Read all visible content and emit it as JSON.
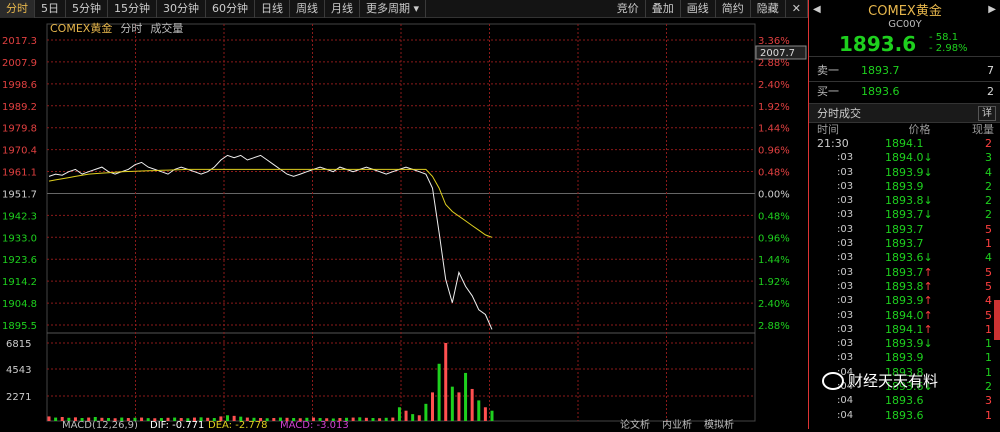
{
  "toolbar": {
    "tabs": [
      "分时",
      "5日",
      "5分钟",
      "15分钟",
      "30分钟",
      "60分钟",
      "日线",
      "周线",
      "月线",
      "更多周期"
    ],
    "right": [
      "竞价",
      "叠加",
      "画线",
      "简约",
      "隐藏"
    ]
  },
  "legend": {
    "title": "COMEX黄金",
    "items": [
      "分时",
      "成交量"
    ]
  },
  "price_axis": {
    "left": [
      "2017.3",
      "2007.9",
      "1998.6",
      "1989.2",
      "1979.8",
      "1970.4",
      "1961.1",
      "1951.7",
      "1942.3",
      "1933.0",
      "1923.6",
      "1914.2",
      "1904.8",
      "1895.5"
    ],
    "right": [
      "3.36%",
      "2.88%",
      "2.40%",
      "1.92%",
      "1.44%",
      "0.96%",
      "0.48%",
      "0.00%",
      "0.48%",
      "0.96%",
      "1.44%",
      "1.92%",
      "2.40%",
      "2.88%"
    ],
    "current_label": "2007.7"
  },
  "volume_axis": [
    "6815",
    "4543",
    "2271"
  ],
  "bottom_bar": [
    "MACD(12,26,9)",
    "DIF: -0.771",
    "DEA: -2.778",
    "MACD: -3.013"
  ],
  "bottom_right": [
    "论文析",
    "内业析",
    "模拟析"
  ],
  "chart_data": {
    "type": "line",
    "ylim": [
      1895.5,
      2017.3
    ],
    "baseline": 1951.7,
    "series": [
      {
        "values": [
          1959,
          1960,
          1959.5,
          1961,
          1962,
          1960,
          1961,
          1962,
          1963,
          1961,
          1960,
          1961,
          1962,
          1964,
          1965,
          1963,
          1962,
          1961,
          1960,
          1962,
          1963,
          1962,
          1961,
          1960,
          1961,
          1963,
          1966,
          1968,
          1967,
          1968,
          1966,
          1967,
          1968,
          1966,
          1964,
          1962,
          1960,
          1959,
          1960,
          1961,
          1962,
          1963,
          1962,
          1961,
          1963,
          1962,
          1961,
          1962,
          1963,
          1962,
          1961,
          1960,
          1961,
          1962,
          1963,
          1962,
          1961,
          1960,
          1954,
          1935,
          1915,
          1905,
          1918,
          1912,
          1908,
          1902,
          1900,
          1893.6
        ]
      },
      {
        "values": [
          1957,
          1957.5,
          1958,
          1958.5,
          1959,
          1959.5,
          1960,
          1960.2,
          1960.4,
          1960.6,
          1960.8,
          1961,
          1961.1,
          1961.2,
          1961.3,
          1961.4,
          1961.5,
          1961.6,
          1961.7,
          1961.8,
          1961.9,
          1962,
          1962,
          1962,
          1962,
          1962,
          1962,
          1962,
          1962,
          1962,
          1962,
          1962,
          1962,
          1962,
          1962,
          1962,
          1962,
          1962,
          1962,
          1962,
          1962,
          1962,
          1962,
          1962,
          1962,
          1962,
          1962,
          1962,
          1962,
          1962,
          1962,
          1962,
          1962,
          1962,
          1962,
          1962,
          1962,
          1962,
          1959,
          1954,
          1947,
          1944,
          1942,
          1940,
          1938,
          1936,
          1934,
          1933
        ]
      }
    ],
    "volume": [
      400,
      300,
      350,
      280,
      320,
      260,
      300,
      350,
      280,
      260,
      240,
      300,
      260,
      280,
      300,
      250,
      240,
      260,
      280,
      300,
      260,
      240,
      300,
      320,
      280,
      260,
      400,
      500,
      450,
      380,
      300,
      280,
      260,
      240,
      260,
      300,
      280,
      260,
      240,
      280,
      300,
      260,
      240,
      220,
      260,
      280,
      300,
      320,
      280,
      260,
      240,
      280,
      300,
      1200,
      900,
      600,
      500,
      1500,
      2500,
      5000,
      6815,
      3000,
      2500,
      4200,
      2800,
      1800,
      1200,
      900
    ]
  },
  "panel": {
    "name": "COMEX黄金",
    "code": "GC00Y",
    "price": "1893.6",
    "change": "- 58.1",
    "change_pct": "- 2.98%",
    "ask_label": "卖一",
    "ask_price": "1893.7",
    "ask_vol": "7",
    "bid_label": "买一",
    "bid_price": "1893.6",
    "bid_vol": "2",
    "section_title": "分时成交",
    "detail_btn": "详",
    "col_time": "时间",
    "col_price": "价格",
    "col_vol": "现量",
    "trades": [
      {
        "time": "21:30",
        "price": "1894.1",
        "arrow": "",
        "vol": "2",
        "dir": "up"
      },
      {
        "time": ":03",
        "price": "1894.0",
        "arrow": "↓",
        "vol": "3",
        "dir": "dn"
      },
      {
        "time": ":03",
        "price": "1893.9",
        "arrow": "↓",
        "vol": "4",
        "dir": "dn"
      },
      {
        "time": ":03",
        "price": "1893.9",
        "arrow": "",
        "vol": "2",
        "dir": "dn"
      },
      {
        "time": ":03",
        "price": "1893.8",
        "arrow": "↓",
        "vol": "2",
        "dir": "dn"
      },
      {
        "time": ":03",
        "price": "1893.7",
        "arrow": "↓",
        "vol": "2",
        "dir": "dn"
      },
      {
        "time": ":03",
        "price": "1893.7",
        "arrow": "",
        "vol": "5",
        "dir": "up"
      },
      {
        "time": ":03",
        "price": "1893.7",
        "arrow": "",
        "vol": "1",
        "dir": "up"
      },
      {
        "time": ":03",
        "price": "1893.6",
        "arrow": "↓",
        "vol": "4",
        "dir": "dn"
      },
      {
        "time": ":03",
        "price": "1893.7",
        "arrow": "↑",
        "vol": "5",
        "dir": "up"
      },
      {
        "time": ":03",
        "price": "1893.8",
        "arrow": "↑",
        "vol": "5",
        "dir": "up"
      },
      {
        "time": ":03",
        "price": "1893.9",
        "arrow": "↑",
        "vol": "4",
        "dir": "up"
      },
      {
        "time": ":03",
        "price": "1894.0",
        "arrow": "↑",
        "vol": "5",
        "dir": "up"
      },
      {
        "time": ":03",
        "price": "1894.1",
        "arrow": "↑",
        "vol": "1",
        "dir": "up"
      },
      {
        "time": ":03",
        "price": "1893.9",
        "arrow": "↓",
        "vol": "1",
        "dir": "dn"
      },
      {
        "time": ":03",
        "price": "1893.9",
        "arrow": "",
        "vol": "1",
        "dir": "dn"
      },
      {
        "time": ":04",
        "price": "1893.8",
        "arrow": "",
        "vol": "1",
        "dir": "dn"
      },
      {
        "time": ":04",
        "price": "1893.6",
        "arrow": "↓",
        "vol": "2",
        "dir": "dn"
      },
      {
        "time": ":04",
        "price": "1893.6",
        "arrow": "",
        "vol": "3",
        "dir": "up"
      },
      {
        "time": ":04",
        "price": "1893.6",
        "arrow": "",
        "vol": "1",
        "dir": "up"
      }
    ]
  },
  "watermark": "财经天天有料"
}
